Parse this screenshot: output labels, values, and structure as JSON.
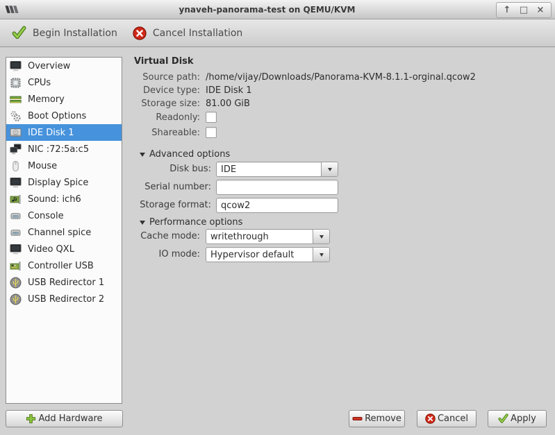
{
  "window": {
    "title": "ynaveh-panorama-test on QEMU/KVM",
    "app_icon": "virt-manager-logo-icon",
    "controls": {
      "shade_glyph": "↑",
      "maximize_glyph": "□",
      "close_glyph": "×"
    }
  },
  "toolbar": {
    "begin_label": "Begin Installation",
    "begin_icon": "green-check-icon",
    "cancel_label": "Cancel Installation",
    "cancel_icon": "red-x-circle-icon"
  },
  "sidebar": {
    "items": [
      {
        "label": "Overview",
        "icon": "monitor-icon",
        "selected": false
      },
      {
        "label": "CPUs",
        "icon": "cpu-icon",
        "selected": false
      },
      {
        "label": "Memory",
        "icon": "memory-icon",
        "selected": false
      },
      {
        "label": "Boot Options",
        "icon": "gears-icon",
        "selected": false
      },
      {
        "label": "IDE Disk 1",
        "icon": "disk-icon",
        "selected": true
      },
      {
        "label": "NIC :72:5a:c5",
        "icon": "network-icon",
        "selected": false
      },
      {
        "label": "Mouse",
        "icon": "mouse-icon",
        "selected": false
      },
      {
        "label": "Display Spice",
        "icon": "monitor-icon",
        "selected": false
      },
      {
        "label": "Sound: ich6",
        "icon": "sound-card-icon",
        "selected": false
      },
      {
        "label": "Console",
        "icon": "serial-console-icon",
        "selected": false
      },
      {
        "label": "Channel spice",
        "icon": "serial-console-icon",
        "selected": false
      },
      {
        "label": "Video QXL",
        "icon": "monitor-icon",
        "selected": false
      },
      {
        "label": "Controller USB",
        "icon": "controller-card-icon",
        "selected": false
      },
      {
        "label": "USB Redirector 1",
        "icon": "usb-icon",
        "selected": false
      },
      {
        "label": "USB Redirector 2",
        "icon": "usb-icon",
        "selected": false
      }
    ]
  },
  "main": {
    "title": "Virtual Disk",
    "fields": [
      {
        "label": "Source path:",
        "value": "/home/vijay/Downloads/Panorama-KVM-8.1.1-orginal.qcow2"
      },
      {
        "label": "Device type:",
        "value": "IDE Disk 1"
      },
      {
        "label": "Storage size:",
        "value": "81.00 GiB"
      }
    ],
    "checkboxes": [
      {
        "label": "Readonly:",
        "checked": false
      },
      {
        "label": "Shareable:",
        "checked": false
      }
    ],
    "advanced": {
      "header": "Advanced options",
      "disk_bus_label": "Disk bus:",
      "disk_bus_value": "IDE",
      "serial_label": "Serial number:",
      "serial_value": "",
      "storage_format_label": "Storage format:",
      "storage_format_value": "qcow2"
    },
    "performance": {
      "header": "Performance options",
      "cache_mode_label": "Cache mode:",
      "cache_mode_value": "writethrough",
      "io_mode_label": "IO mode:",
      "io_mode_value": "Hypervisor default"
    }
  },
  "footer": {
    "add_hardware_label": "Add Hardware",
    "add_hardware_icon": "plus-icon",
    "remove_label": "Remove",
    "remove_icon": "minus-icon",
    "cancel_label": "Cancel",
    "cancel_icon": "red-x-circle-icon",
    "apply_label": "Apply",
    "apply_icon": "green-check-icon"
  },
  "colors": {
    "selection_blue": "#4692dc",
    "success_green": "#8bc341",
    "danger_red": "#cf2a1b"
  }
}
